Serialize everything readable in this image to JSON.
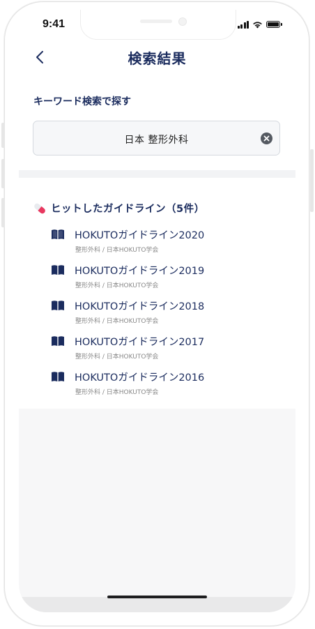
{
  "status_bar": {
    "time": "9:41"
  },
  "nav": {
    "title": "検索結果",
    "back_icon": "chevron-left-icon"
  },
  "search": {
    "section_label": "キーワード検索で探す",
    "value": "日本 整形外科",
    "clear_icon": "clear-circle-icon"
  },
  "results": {
    "header": "ヒットしたガイドライン（5件）",
    "header_icon": "pill-icon",
    "items": [
      {
        "title": "HOKUTOガイドライン2020",
        "subtitle": "整形外科 / 日本HOKUTO学会"
      },
      {
        "title": "HOKUTOガイドライン2019",
        "subtitle": "整形外科 / 日本HOKUTO学会"
      },
      {
        "title": "HOKUTOガイドライン2018",
        "subtitle": "整形外科 / 日本HOKUTO学会"
      },
      {
        "title": "HOKUTOガイドライン2017",
        "subtitle": "整形外科 / 日本HOKUTO学会"
      },
      {
        "title": "HOKUTOガイドライン2016",
        "subtitle": "整形外科 / 日本HOKUTO学会"
      }
    ]
  },
  "colors": {
    "primary_navy": "#1b2c5e",
    "accent_pink": "#e8385f",
    "subtext_gray": "#888888",
    "search_bg": "#f6f7f9"
  }
}
